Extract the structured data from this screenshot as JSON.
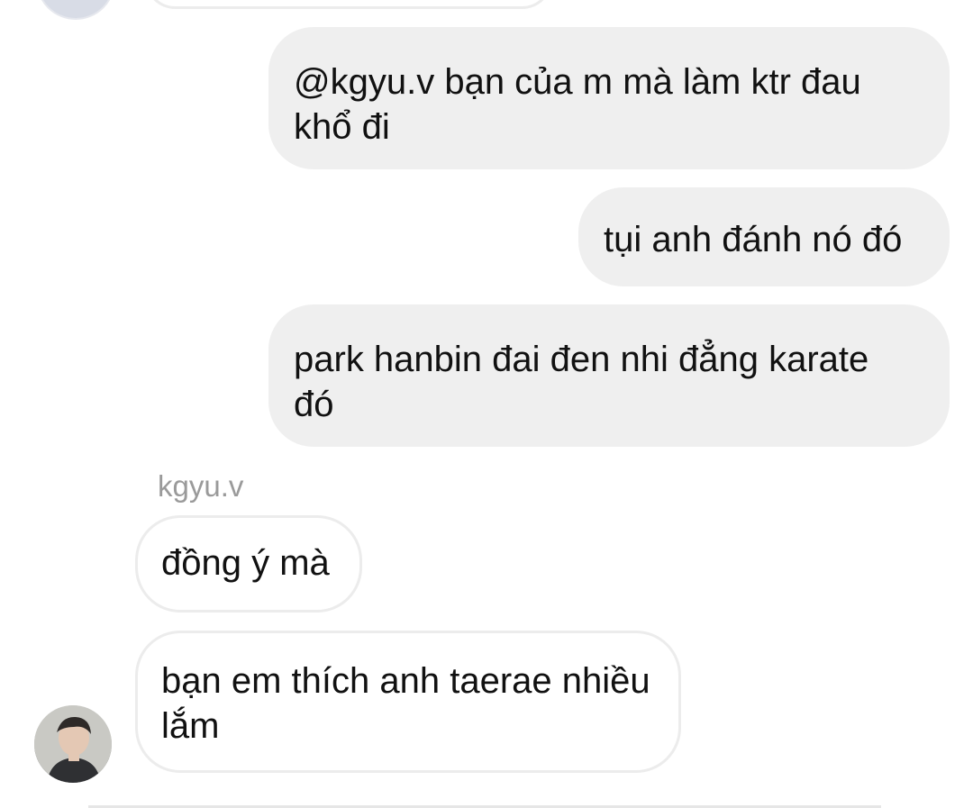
{
  "messages": {
    "out_1": "@kgyu.v bạn của m mà làm ktr đau khổ đi",
    "out_2": "tụi anh đánh nó đó",
    "out_3": "park hanbin đai đen nhi đẳng karate đó",
    "sender_name": "kgyu.v",
    "in_1": "đồng ý mà",
    "in_2": "bạn em thích anh taerae nhiều lắm"
  }
}
